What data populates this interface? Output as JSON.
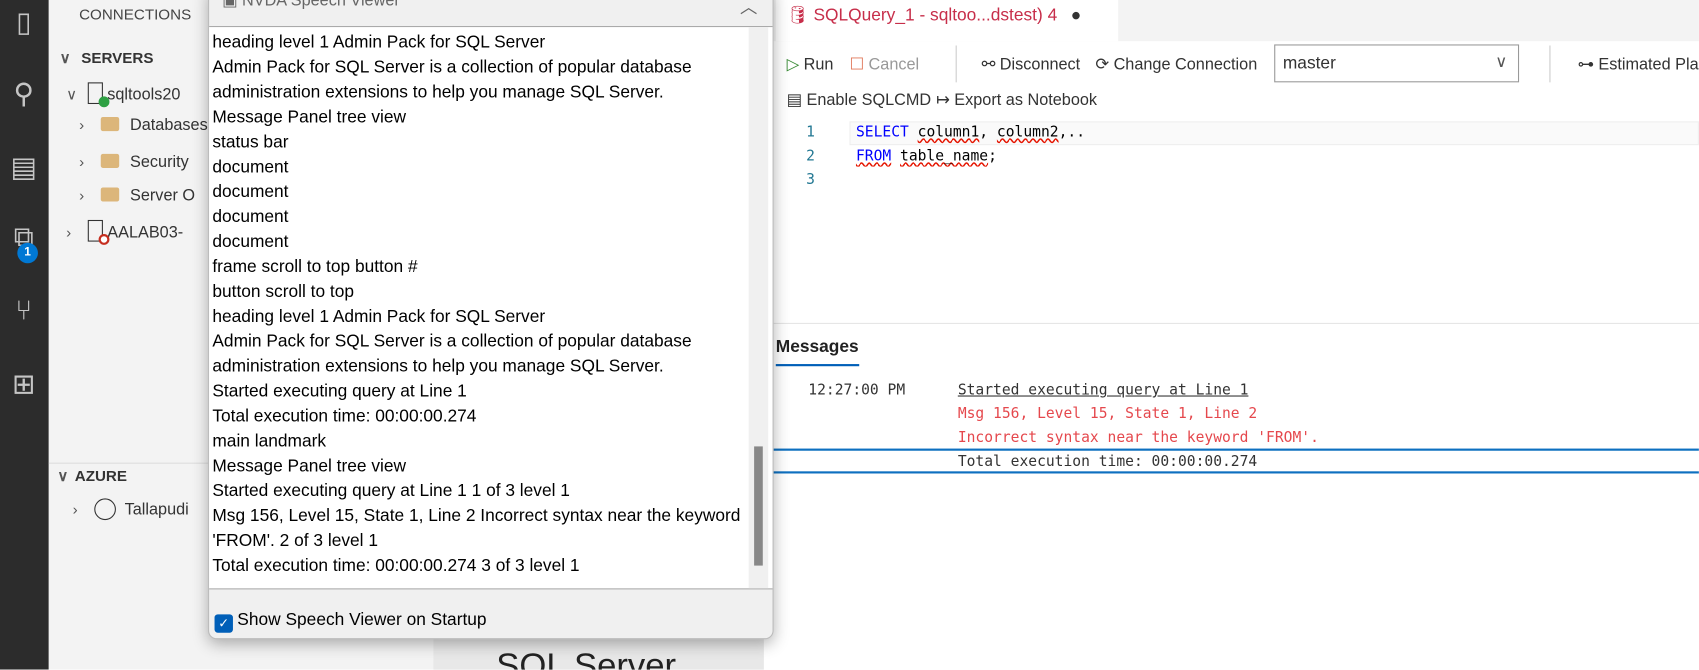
{
  "activity_bar": {
    "badge": "1"
  },
  "sidebar": {
    "title": "CONNECTIONS",
    "servers_header": "SERVERS",
    "servers": [
      {
        "label": "sqltools20",
        "status": "connected",
        "children": [
          "Databases",
          "Security",
          "Server O"
        ]
      },
      {
        "label": "AALAB03-",
        "status": "disconnected"
      }
    ],
    "azure_header": "AZURE",
    "azure_account": "Tallapudi"
  },
  "background_text": "SQL Server",
  "speech_viewer": {
    "title": "NVDA Speech Viewer",
    "lines": [
      "heading    level 1  Admin Pack for SQL Server",
      "Admin Pack for SQL Server is a collection of popular database",
      "administration extensions to help you   manage SQL Server.",
      "Message Panel  tree view",
      "status bar",
      "document",
      "document",
      "document",
      "document",
      "frame    scroll to top  button    #",
      "button    scroll to top",
      "heading    level 1  Admin Pack for SQL Server",
      "Admin Pack for SQL Server is a collection of popular database",
      "administration extensions to help you   manage SQL Server.",
      "Started executing query at Line 1",
      "Total execution time: 00:00:00.274",
      "main landmark",
      "Message Panel  tree view",
      "Started executing query at Line 1  1 of 3  level 1",
      "Msg 156, Level 15, State 1, Line 2 Incorrect syntax near the keyword",
      "'FROM'.  2 of 3  level 1",
      "Total execution time: 00:00:00.274  3 of 3  level 1"
    ],
    "show_on_startup_label": "Show Speech Viewer on Startup",
    "show_on_startup_checked": true
  },
  "editor": {
    "tab_title": "SQLQuery_1 - sqltoo...dstest)",
    "tab_problems": "4",
    "toolbar": {
      "run": "Run",
      "cancel": "Cancel",
      "disconnect": "Disconnect",
      "change_connection": "Change Connection",
      "database": "master",
      "estimated_plan": "Estimated Plan",
      "enable_sqlcmd": "Enable SQLCMD",
      "export_notebook": "Export as Notebook"
    },
    "code": {
      "line_numbers": [
        "1",
        "2",
        "3"
      ],
      "line1_kw": "SELECT",
      "line1_a": "column1",
      "line1_sep": ", ",
      "line1_b": "column2",
      ",line1_rest": "",
      "line1_tail": ",..",
      "line2_kw": "FROM",
      "line2_rest": "table_name",
      "line2_tail": ";"
    },
    "messages": {
      "tab": "Messages",
      "time": "12:27:00 PM",
      "started": "Started executing query at Line 1",
      "error1": "Msg 156, Level 15, State 1, Line 2",
      "error2": "Incorrect syntax near the keyword 'FROM'.",
      "total": "Total execution time: 00:00:00.274"
    }
  },
  "colors": {
    "accent": "#005fb8",
    "error": "#e51400",
    "tab_text": "#c72e4a",
    "keyword": "#0000ff"
  }
}
